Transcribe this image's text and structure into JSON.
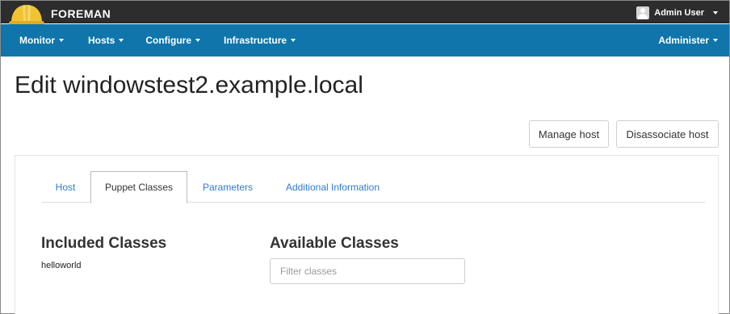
{
  "header": {
    "brand": "FOREMAN",
    "user": "Admin User"
  },
  "nav": {
    "monitor": "Monitor",
    "hosts": "Hosts",
    "configure": "Configure",
    "infrastructure": "Infrastructure",
    "administer": "Administer"
  },
  "page": {
    "title": "Edit windowstest2.example.local"
  },
  "actions": {
    "manage_host": "Manage host",
    "disassociate_host": "Disassociate host"
  },
  "tabs": [
    {
      "label": "Host",
      "active": false
    },
    {
      "label": "Puppet Classes",
      "active": true
    },
    {
      "label": "Parameters",
      "active": false
    },
    {
      "label": "Additional Information",
      "active": false
    }
  ],
  "puppet": {
    "included_title": "Included Classes",
    "included_classes": [
      "helloworld"
    ],
    "available_title": "Available Classes",
    "filter": {
      "value": "",
      "placeholder": "Filter classes"
    }
  },
  "colors": {
    "header_bg": "#2d2d2d",
    "nav_bg": "#0f75aa",
    "link": "#2e7bcf",
    "hardhat": "#f1c232"
  },
  "icons": {
    "logo": "hardhat-icon",
    "avatar": "user-avatar-icon",
    "dropdown": "caret-down-icon"
  }
}
